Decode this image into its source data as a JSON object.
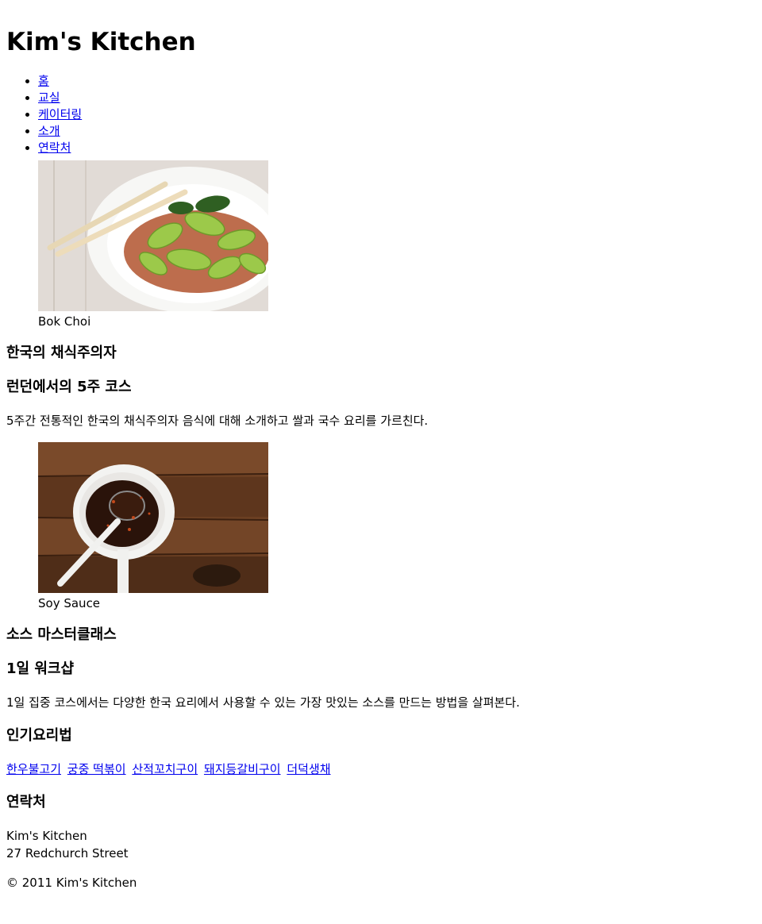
{
  "site": {
    "title": "Kim's Kitchen"
  },
  "nav": {
    "items": [
      {
        "label": "홈"
      },
      {
        "label": "교실"
      },
      {
        "label": "케이터링"
      },
      {
        "label": "소개"
      },
      {
        "label": "연락처"
      }
    ]
  },
  "classes": [
    {
      "caption": "Bok Choi",
      "heading": "한국의 채식주의자",
      "subheading": "런던에서의 5주 코스",
      "description": "5주간 전통적인 한국의 채식주의자 음식에 대해 소개하고 쌀과 국수 요리를 가르친다."
    },
    {
      "caption": "Soy Sauce",
      "heading": "소스 마스터클래스",
      "subheading": "1일 워크샵",
      "description": "1일 집중 코스에서는 다양한 한국 요리에서 사용할 수 있는 가장 맛있는 소스를 만드는 방법을 살펴본다."
    }
  ],
  "recipes": {
    "heading": "인기요리법",
    "links": [
      "한우불고기",
      "궁중 떡볶이",
      "산적꼬치구이",
      "돼지등갈비구이",
      "더덕생채"
    ]
  },
  "contact": {
    "heading": "연락처",
    "name": "Kim's Kitchen",
    "address": "27 Redchurch Street"
  },
  "footer": {
    "copyright": "© 2011 Kim's Kitchen"
  },
  "colors": {
    "link": "#0000ee",
    "text": "#000000",
    "background": "#ffffff"
  }
}
